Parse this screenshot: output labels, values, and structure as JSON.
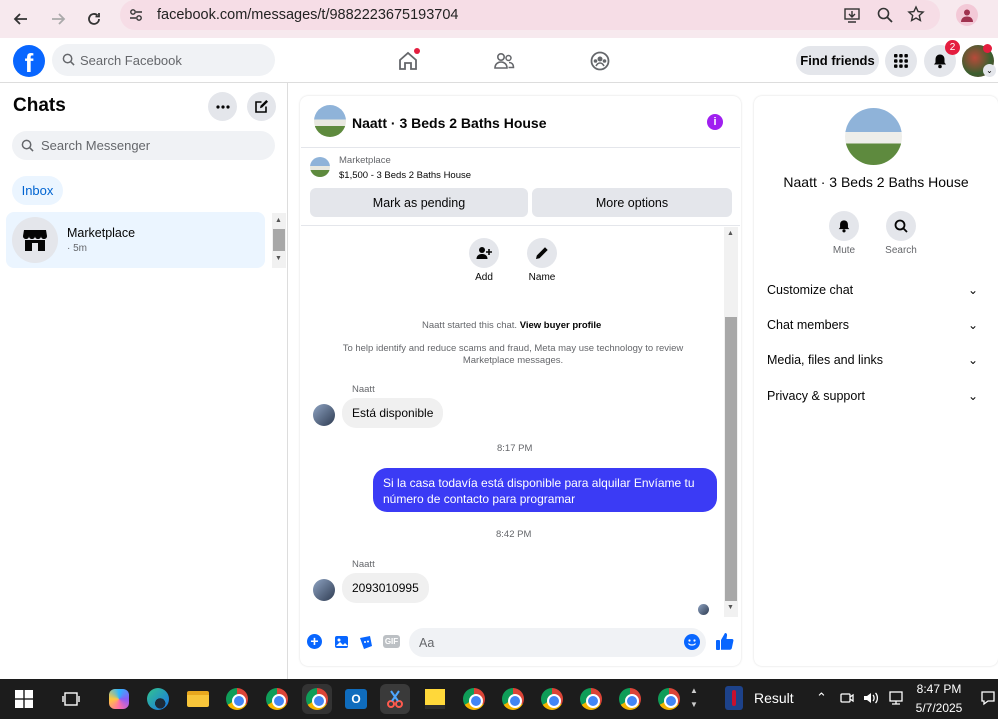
{
  "browser": {
    "url": "facebook.com/messages/t/9882223675193704"
  },
  "fb_header": {
    "search_placeholder": "Search Facebook",
    "find_friends": "Find friends",
    "notification_count": "2"
  },
  "sidebar": {
    "title": "Chats",
    "search_placeholder": "Search Messenger",
    "filter_tab": "Inbox",
    "conversations": [
      {
        "name": "Marketplace",
        "time": "· 5m"
      }
    ]
  },
  "conversation": {
    "title": "Naatt · 3 Beds 2 Baths House",
    "marketplace_label": "Marketplace",
    "listing": "$1,500 - 3 Beds 2 Baths House",
    "mark_pending": "Mark as pending",
    "more_options": "More options",
    "actions": [
      {
        "label": "Add",
        "icon": "add-person-icon"
      },
      {
        "label": "Name",
        "icon": "pencil-icon"
      }
    ],
    "started_text": "Naatt started this chat.",
    "view_buyer_profile": "View buyer profile",
    "safety_notice": "To help identify and reduce scams and fraud, Meta may use technology to review Marketplace messages.",
    "messages": [
      {
        "sender": "Naatt",
        "text": "Está disponible",
        "direction": "in"
      },
      {
        "timestamp": "8:17 PM"
      },
      {
        "text": "Si la casa todavía está disponible para alquilar Envíame tu número de contacto para programar",
        "direction": "out"
      },
      {
        "timestamp": "8:42 PM"
      },
      {
        "sender": "Naatt",
        "text": "2093010995",
        "direction": "in"
      }
    ],
    "composer_placeholder": "Aa"
  },
  "right_panel": {
    "title": "Naatt · 3 Beds 2 Baths House",
    "actions": [
      {
        "label": "Mute",
        "icon": "bell-icon"
      },
      {
        "label": "Search",
        "icon": "search-icon"
      }
    ],
    "sections": [
      "Customize chat",
      "Chat members",
      "Media, files and links",
      "Privacy & support"
    ]
  },
  "taskbar": {
    "search_result": "Result",
    "time": "8:47 PM",
    "date": "5/7/2025"
  },
  "colors": {
    "accent": "#0866ff",
    "bubble_out": "#3b3bf5",
    "info_icon": "#a020f0"
  }
}
